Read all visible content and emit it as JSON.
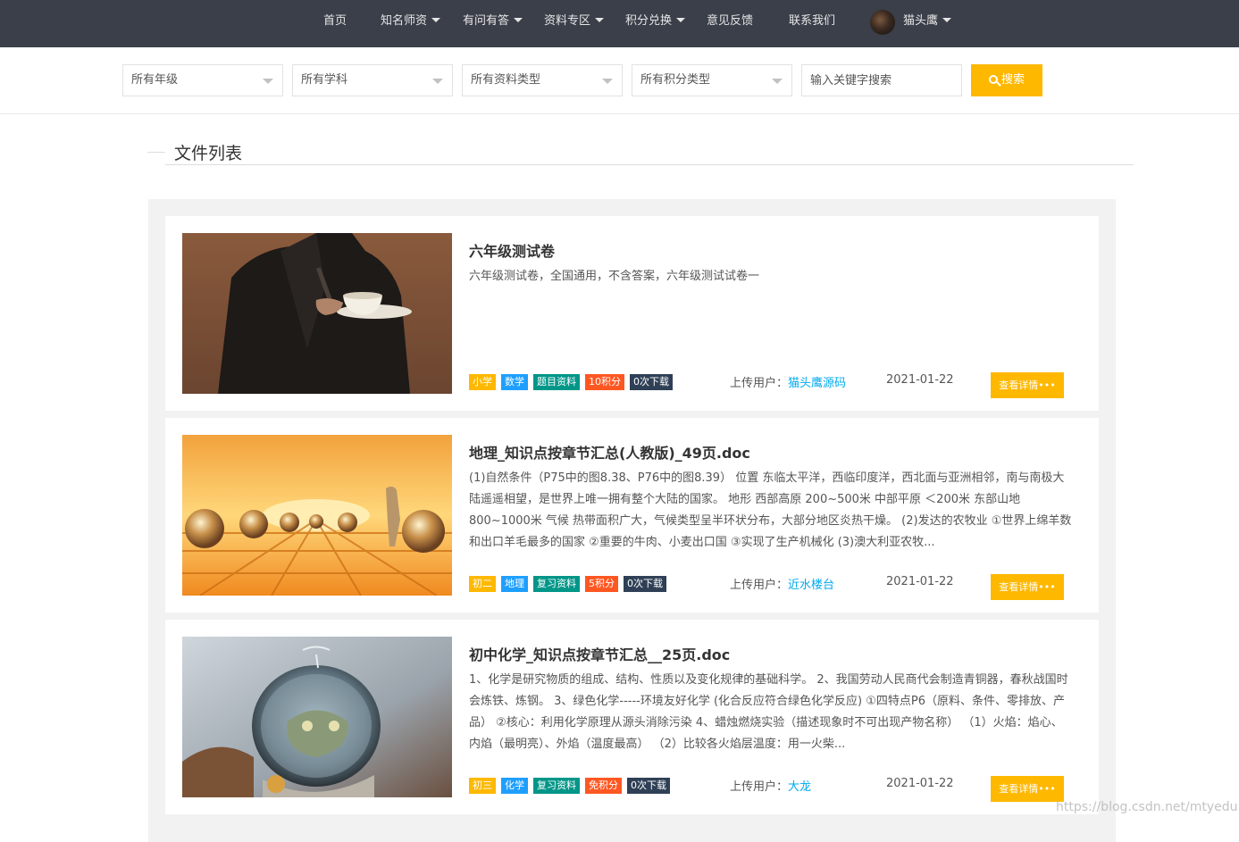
{
  "nav": {
    "items": [
      {
        "label": "首页",
        "dropdown": false
      },
      {
        "label": "知名师资",
        "dropdown": true
      },
      {
        "label": "有问有答",
        "dropdown": true
      },
      {
        "label": "资料专区",
        "dropdown": true
      },
      {
        "label": "积分兑换",
        "dropdown": true
      },
      {
        "label": "意见反馈",
        "dropdown": false
      },
      {
        "label": "联系我们",
        "dropdown": false
      }
    ],
    "user": {
      "name": "猫头鹰"
    }
  },
  "filters": {
    "grade": "所有年级",
    "subject": "所有学科",
    "resource_type": "所有资料类型",
    "points_type": "所有积分类型",
    "search_placeholder": "输入关键字搜索",
    "search_label": "搜索"
  },
  "section": {
    "title": "文件列表"
  },
  "files": [
    {
      "title": "六年级测试卷",
      "description": "六年级测试卷，全国通用，不含答案，六年级测试试卷一",
      "tags": [
        {
          "text": "小学",
          "color": "#ffb800"
        },
        {
          "text": "数学",
          "color": "#1e9fff"
        },
        {
          "text": "题目资料",
          "color": "#009688"
        },
        {
          "text": "10积分",
          "color": "#ff5722"
        },
        {
          "text": "0次下载",
          "color": "#2f4056"
        }
      ],
      "uploader_label": "上传用户：",
      "uploader": "猫头鹰源码",
      "date": "2021-01-22",
      "detail_label": "查看详情•••"
    },
    {
      "title": "地理_知识点按章节汇总(人教版)_49页.doc",
      "description": "(1)自然条件（P75中的图8.38、P76中的图8.39） 位置 东临太平洋，西临印度洋，西北面与亚洲相邻，南与南极大陆遥遥相望，是世界上唯一拥有整个大陆的国家。 地形 西部高原 200~500米 中部平原 ＜200米 东部山地 800~1000米 气候 热带面积广大，气候类型呈半环状分布，大部分地区炎热干燥。 (2)发达的农牧业 ①世界上绵羊数和出口羊毛最多的国家 ②重要的牛肉、小麦出口国 ③实现了生产机械化 (3)澳大利亚农牧...",
      "tags": [
        {
          "text": "初二",
          "color": "#ffb800"
        },
        {
          "text": "地理",
          "color": "#1e9fff"
        },
        {
          "text": "复习资料",
          "color": "#009688"
        },
        {
          "text": "5积分",
          "color": "#ff5722"
        },
        {
          "text": "0次下载",
          "color": "#2f4056"
        }
      ],
      "uploader_label": "上传用户：",
      "uploader": "近水楼台",
      "date": "2021-01-22",
      "detail_label": "查看详情•••"
    },
    {
      "title": "初中化学_知识点按章节汇总__25页.doc",
      "description": "1、化学是研究物质的组成、结构、性质以及变化规律的基础科学。 2、我国劳动人民商代会制造青铜器，春秋战国时会炼铁、炼钢。 3、绿色化学-----环境友好化学 (化合反应符合绿色化学反应) ①四特点P6（原料、条件、零排放、产品） ②核心：利用化学原理从源头消除污染 4、蜡烛燃烧实验（描述现象时不可出现产物名称） （1）火焰：焰心、内焰（最明亮）、外焰（温度最高） （2）比较各火焰层温度：用一火柴...",
      "tags": [
        {
          "text": "初三",
          "color": "#ffb800"
        },
        {
          "text": "化学",
          "color": "#1e9fff"
        },
        {
          "text": "复习资料",
          "color": "#009688"
        },
        {
          "text": "免积分",
          "color": "#ff5722"
        },
        {
          "text": "0次下载",
          "color": "#2f4056"
        }
      ],
      "uploader_label": "上传用户：",
      "uploader": "大龙",
      "date": "2021-01-22",
      "detail_label": "查看详情•••"
    }
  ],
  "watermark": "https://blog.csdn.net/mtyedu"
}
